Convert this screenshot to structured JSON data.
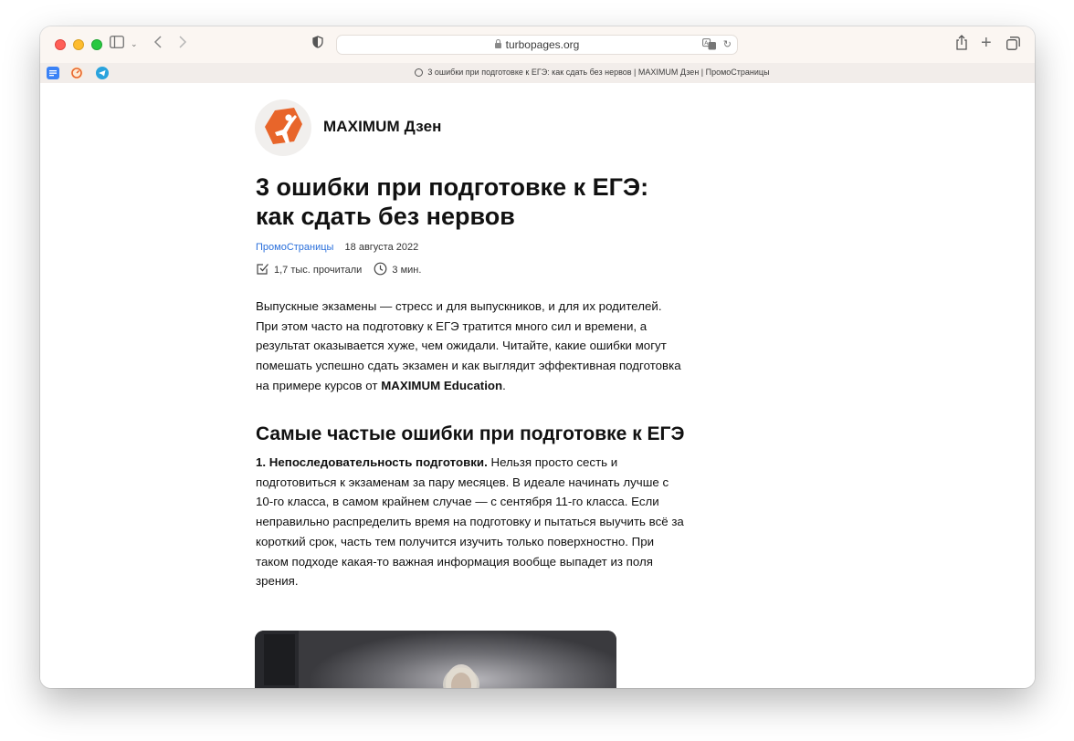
{
  "browser": {
    "url": "turbopages.org",
    "tab_title": "3 ошибки при подготовке к ЕГЭ: как сдать без нервов | MAXIMUM Дзен | ПромоСтраницы"
  },
  "article": {
    "brand": "MAXIMUM Дзен",
    "title": "3 ошибки при подготовке к ЕГЭ: как сдать без нервов",
    "source": "ПромоСтраницы",
    "date": "18 августа 2022",
    "views": "1,7 тыс. прочитали",
    "read_time": "3 мин.",
    "intro_text": "Выпускные экзамены — стресс и для выпускников, и для их родителей. При этом часто на подготовку к ЕГЭ тратится много сил и времени, а результат оказывается хуже, чем ожидали. Читайте, какие ошибки могут помешать успешно сдать экзамен и как выглядит эффективная подготовка на примере курсов от ",
    "intro_bold": "MAXIMUM Education",
    "intro_end": ".",
    "section_heading": "Самые частые ошибки при подготовке к ЕГЭ",
    "point1_bold": "1. Непоследовательность подготовки.",
    "point1_text": " Нельзя просто сесть и подготовиться к экзаменам за пару месяцев. В идеале начинать лучше с 10-го класса, в самом крайнем случае — с сентября 11-го класса. Если неправильно распределить время на подготовку и пытаться выучить всё за короткий срок, часть тем получится изучить только поверхностно. При таком подходе какая-то важная информация вообще выпадет из поля зрения."
  },
  "colors": {
    "accent_link": "#2a6fdb",
    "logo_orange": "#e8652a"
  }
}
